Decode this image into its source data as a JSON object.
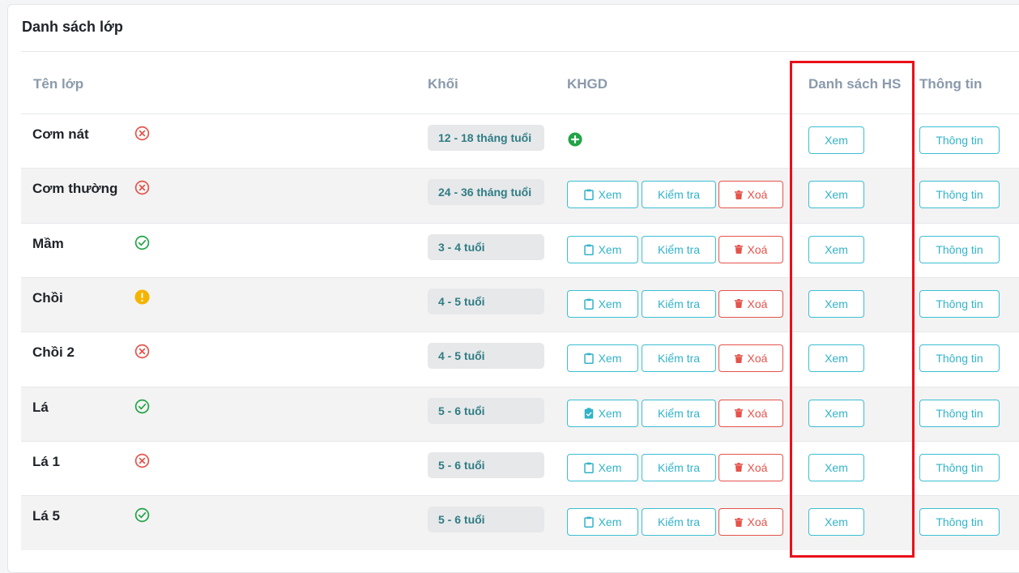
{
  "panel": {
    "title": "Danh sách lớp"
  },
  "table": {
    "headers": {
      "class_name": "Tên lớp",
      "grade": "Khối",
      "khgd": "KHGD",
      "student_list": "Danh sách HS",
      "info": "Thông tin"
    },
    "rows": [
      {
        "name": "Cơm nát",
        "status": "error",
        "grade": "12 - 18 tháng tuổi",
        "khgd": "add"
      },
      {
        "name": "Cơm thường",
        "status": "error",
        "grade": "24 - 36 tháng tuổi",
        "khgd": "actions"
      },
      {
        "name": "Mầm",
        "status": "ok",
        "grade": "3 - 4 tuổi",
        "khgd": "actions"
      },
      {
        "name": "Chồi",
        "status": "warning",
        "grade": "4 - 5 tuổi",
        "khgd": "actions"
      },
      {
        "name": "Chồi 2",
        "status": "error",
        "grade": "4 - 5 tuổi",
        "khgd": "actions"
      },
      {
        "name": "Lá",
        "status": "ok",
        "grade": "5 - 6 tuổi",
        "khgd": "actions",
        "view_icon": "clipboard-check-icon"
      },
      {
        "name": "Lá 1",
        "status": "error",
        "grade": "5 - 6 tuổi",
        "khgd": "actions"
      },
      {
        "name": "Lá 5",
        "status": "ok",
        "grade": "5 - 6 tuổi",
        "khgd": "actions"
      }
    ]
  },
  "buttons": {
    "view_label": "Xem",
    "check_label": "Kiểm tra",
    "delete_label": "Xoá",
    "student_list_label": "Xem",
    "info_label": "Thông tin"
  },
  "colors": {
    "accent": "#32b3c9",
    "danger": "#e5534b",
    "ok": "#22a447",
    "warning": "#f5b400",
    "highlight_box": "#e8101a"
  }
}
